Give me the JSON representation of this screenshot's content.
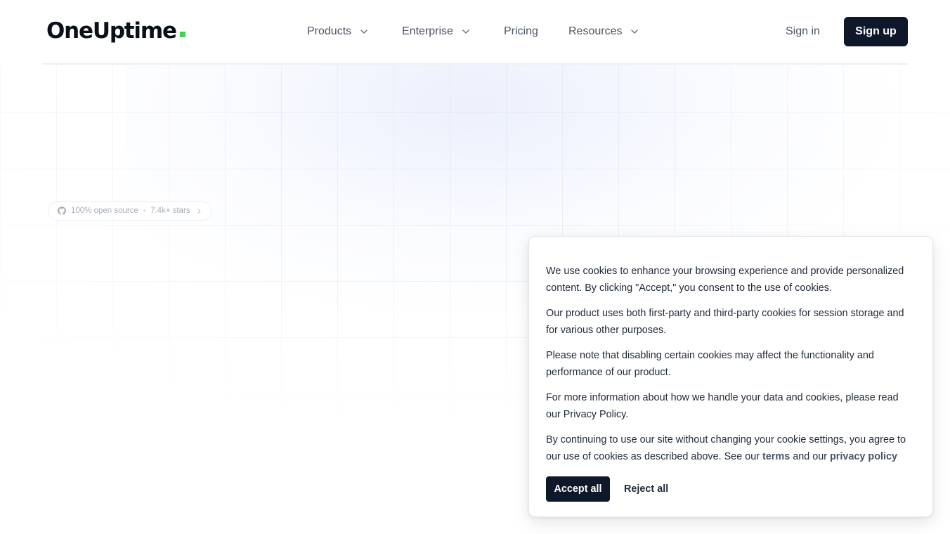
{
  "colors": {
    "brand_dot": "#3fd15a",
    "primary_button": "#0f172a",
    "nav_text": "#4b5563"
  },
  "header": {
    "logo_text": "OneUptime",
    "nav": [
      {
        "label": "Products",
        "has_dropdown": true,
        "icon": "chevron-down-icon"
      },
      {
        "label": "Enterprise",
        "has_dropdown": true,
        "icon": "chevron-down-icon"
      },
      {
        "label": "Pricing",
        "has_dropdown": false
      },
      {
        "label": "Resources",
        "has_dropdown": true,
        "icon": "chevron-down-icon"
      }
    ],
    "sign_in": "Sign in",
    "sign_up": "Sign up"
  },
  "hero": {
    "badge": {
      "icon": "github-icon",
      "label": "100% open source",
      "stars": "7.4k+ stars",
      "arrow_icon": "chevron-right-icon"
    }
  },
  "cookie_banner": {
    "p1": "We use cookies to enhance your browsing experience and provide personalized content. By clicking \"Accept,\" you consent to the use of cookies.",
    "p2": "Our product uses both first-party and third-party cookies for session storage and for various other purposes.",
    "p3": "Please note that disabling certain cookies may affect the functionality and performance of our product.",
    "p4": "For more information about how we handle your data and cookies, please read our Privacy Policy.",
    "p5_before": "By continuing to use our site without changing your cookie settings, you agree to our use of cookies as described above. See our ",
    "terms_link": "terms",
    "p5_middle": " and our ",
    "privacy_link": "privacy policy",
    "accept_all": "Accept all",
    "reject_all": "Reject all"
  }
}
